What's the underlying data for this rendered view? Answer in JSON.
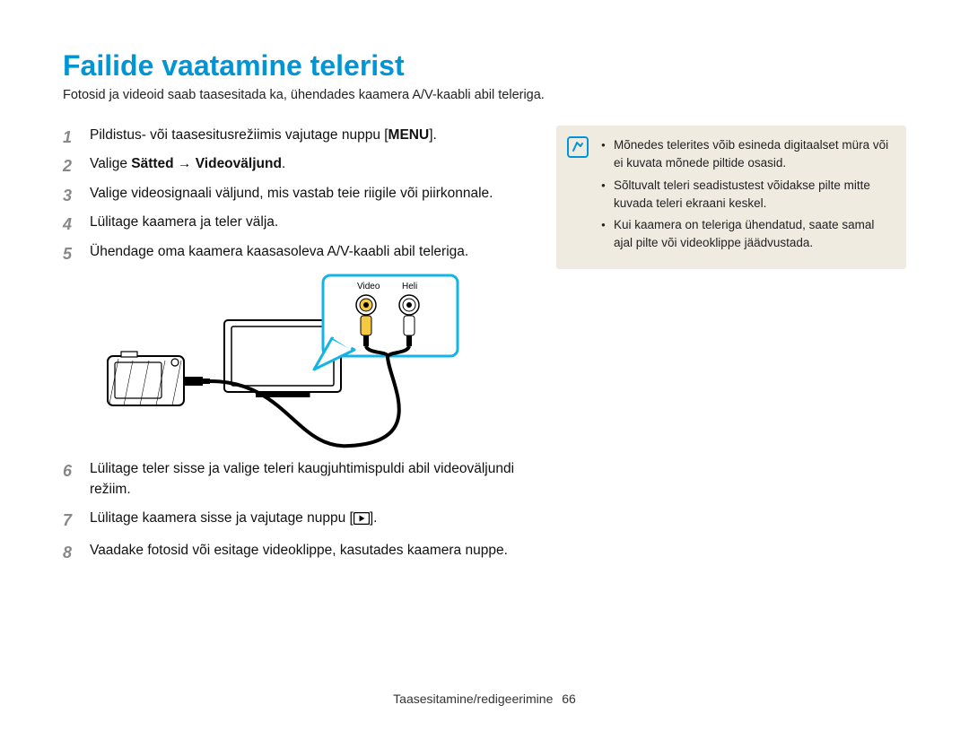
{
  "title": "Failide vaatamine telerist",
  "subtitle": "Fotosid ja videoid saab taasesitada ka, ühendades kaamera A/V-kaabli abil teleriga.",
  "steps": [
    {
      "n": "1",
      "pre": "Pildistus- või taasesitusrežiimis vajutage nuppu [",
      "menu": "MENU",
      "post": "]."
    },
    {
      "n": "2",
      "pre": "Valige ",
      "bold": "Sätted → Videoväljund",
      "post": "."
    },
    {
      "n": "3",
      "text": "Valige videosignaali väljund, mis vastab teie riigile või piirkonnale."
    },
    {
      "n": "4",
      "text": "Lülitage kaamera ja teler välja."
    },
    {
      "n": "5",
      "text": "Ühendage oma kaamera kaasasoleva A/V-kaabli abil teleriga."
    },
    {
      "n": "6",
      "text": "Lülitage teler sisse ja valige teleri kaugjuhtimispuldi abil videoväljundi režiim."
    },
    {
      "n": "7",
      "pre": "Lülitage kaamera sisse ja vajutage nuppu [",
      "playicon": true,
      "post": "]."
    },
    {
      "n": "8",
      "text": "Vaadake fotosid või esitage videoklippe, kasutades kaamera nuppe."
    }
  ],
  "diagram": {
    "video": "Video",
    "heli": "Heli"
  },
  "notes": [
    "Mõnedes telerites võib esineda digitaalset müra või ei kuvata mõnede piltide osasid.",
    "Sõltuvalt teleri seadistustest võidakse pilte mitte kuvada teleri ekraani keskel.",
    "Kui kaamera on teleriga ühendatud, saate samal ajal pilte või videoklippe jäädvustada."
  ],
  "footer": {
    "section": "Taasesitamine/redigeerimine",
    "page": "66"
  }
}
